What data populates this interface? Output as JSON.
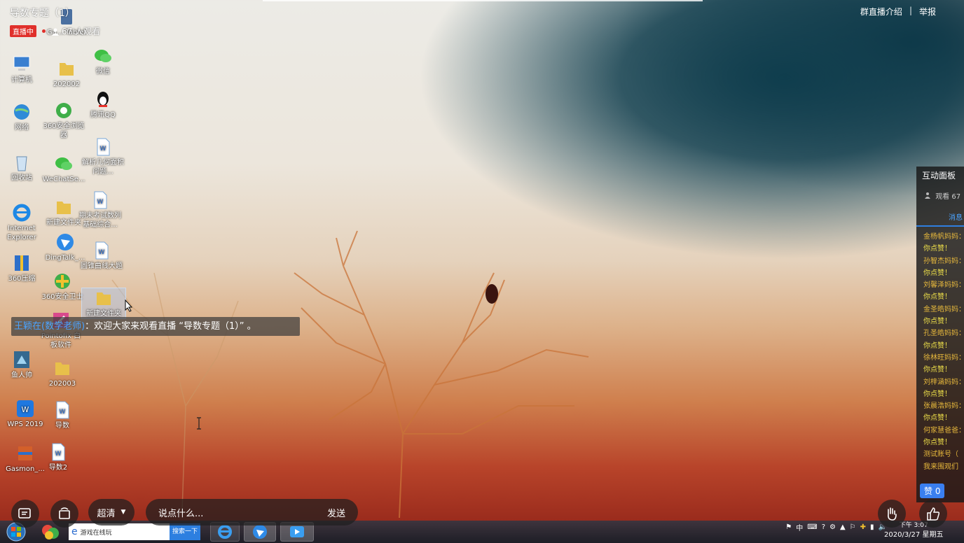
{
  "stream": {
    "title": "导数专题（1）",
    "live_badge": "直播中",
    "viewers": "67 人观看",
    "links": {
      "intro": "群直播介绍",
      "separator": "|",
      "report": "举报"
    }
  },
  "desktop_icons": [
    {
      "label": "计算机"
    },
    {
      "label": "网络"
    },
    {
      "label": "回收站"
    },
    {
      "label": "Internet Explorer"
    },
    {
      "label": "360压缩"
    },
    {
      "label": "鱼人帅"
    },
    {
      "label": "WPS 2019"
    },
    {
      "label": "Gasmon_..."
    },
    {
      "label": "Ga... Tablet"
    },
    {
      "label": "202002"
    },
    {
      "label": "360安全浏览器"
    },
    {
      "label": "WeChatSe..."
    },
    {
      "label": "新建文件夹"
    },
    {
      "label": "DingTalk_..."
    },
    {
      "label": "360安全卫士"
    },
    {
      "label": "Pointofix 白板软件"
    },
    {
      "label": "202003"
    },
    {
      "label": "导数"
    },
    {
      "label": "导数2"
    },
    {
      "label": "微信"
    },
    {
      "label": "腾讯QQ"
    },
    {
      "label": "解析几何面积问题..."
    },
    {
      "label": "期末考试数列基础综合..."
    },
    {
      "label": "圆锥曲线大题"
    },
    {
      "label": "新建文件夹"
    }
  ],
  "welcome": {
    "sender": "王颖在(数学老师)",
    "text": "：欢迎大家来观看直播 “导数专题（1）” 。"
  },
  "panel": {
    "title": "互动面板",
    "viewers": "观看 67",
    "tab": "消息",
    "messages": [
      {
        "name": "金杨帆妈妈：",
        "text": "你点赞！"
      },
      {
        "name": "孙智杰妈妈：",
        "text": "你点赞！"
      },
      {
        "name": "刘馨泽妈妈：",
        "text": "你点赞！"
      },
      {
        "name": "金圣皓妈妈：",
        "text": "你点赞！"
      },
      {
        "name": "孔圣皓妈妈：",
        "text": "你点赞！"
      },
      {
        "name": "徐林旺妈妈：",
        "text": "你点赞！"
      },
      {
        "name": "刘梓涵妈妈：",
        "text": "你点赞！"
      },
      {
        "name": "张晨浩妈妈：",
        "text": "你点赞！"
      },
      {
        "name": "何家慧爸爸：",
        "text": "你点赞！"
      },
      {
        "name": "测试账号（",
        "text": ""
      },
      {
        "name": "我来围观们",
        "text": ""
      }
    ],
    "like_label": "赞 0"
  },
  "controls": {
    "quality": "超清",
    "comment_placeholder": "说点什么...",
    "send": "发送"
  },
  "taskbar": {
    "search_text": "游戏在线玩",
    "search_button": "搜索一下",
    "ime": "中",
    "time": "下午 3:07",
    "date": "2020/3/27 星期五"
  },
  "colors": {
    "accent_blue": "#3a7ff0",
    "live_red": "#e0302b",
    "chat_name": "#e8b93c"
  }
}
